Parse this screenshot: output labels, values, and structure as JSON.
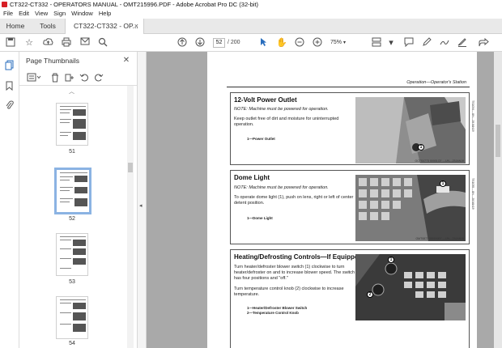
{
  "window": {
    "title": "CT322-CT332 - OPERATORS MANUAL - OMT215996.PDF - Adobe Acrobat Pro DC (32-bit)"
  },
  "menu": [
    "File",
    "Edit",
    "View",
    "Sign",
    "Window",
    "Help"
  ],
  "tabs": {
    "home": "Home",
    "tools": "Tools",
    "document": "CT322-CT332 - OP...",
    "close_symbol": "×"
  },
  "toolbar": {
    "current_page": "52",
    "total_pages": "/ 200",
    "zoom": "75%"
  },
  "thumbnails_panel": {
    "title": "Page Thumbnails",
    "close_symbol": "✕",
    "pages": [
      {
        "label": "51",
        "selected": false
      },
      {
        "label": "52",
        "selected": true
      },
      {
        "label": "53",
        "selected": false
      },
      {
        "label": "54",
        "selected": false
      }
    ]
  },
  "document": {
    "header": "Operation—Operator's Station",
    "sections": [
      {
        "title": "12-Volt Power Outlet",
        "note": "NOTE: Machine must be powered for operation.",
        "body": "Keep outlet free of dirt and moisture for uninterrupted operation.",
        "captions": [
          "1—Power Outlet"
        ],
        "callouts": [
          "1"
        ],
        "photo_ref": "OCTS4773 00001CE —UN—23JAN19",
        "side_ref": "TS1034—UN—28JAN19"
      },
      {
        "title": "Dome Light",
        "note": "NOTE: Machine must be powered for operation.",
        "body": "To operate dome light (1), push on lens, right or left of center detent position.",
        "captions": [
          "1—Dome Light"
        ],
        "callouts": [
          "1"
        ],
        "photo_ref": "OMT0877 00000007 —UN—23JAN19",
        "side_ref": "TS1035—UN—28JAN19"
      },
      {
        "title": "Heating/Defrosting Controls—If Equipped",
        "body1": "Turn heater/defroster blower switch (1) clockwise to turn heater/defroster on and to increase blower speed. The switch has four positions and \"off.\"",
        "body2": "Turn temperature control knob (2) clockwise to increase temperature.",
        "captions": [
          "1—Heater/Defroster Blower Switch",
          "2—Temperature Control Knob"
        ],
        "callouts": [
          "1",
          "2"
        ]
      }
    ]
  }
}
